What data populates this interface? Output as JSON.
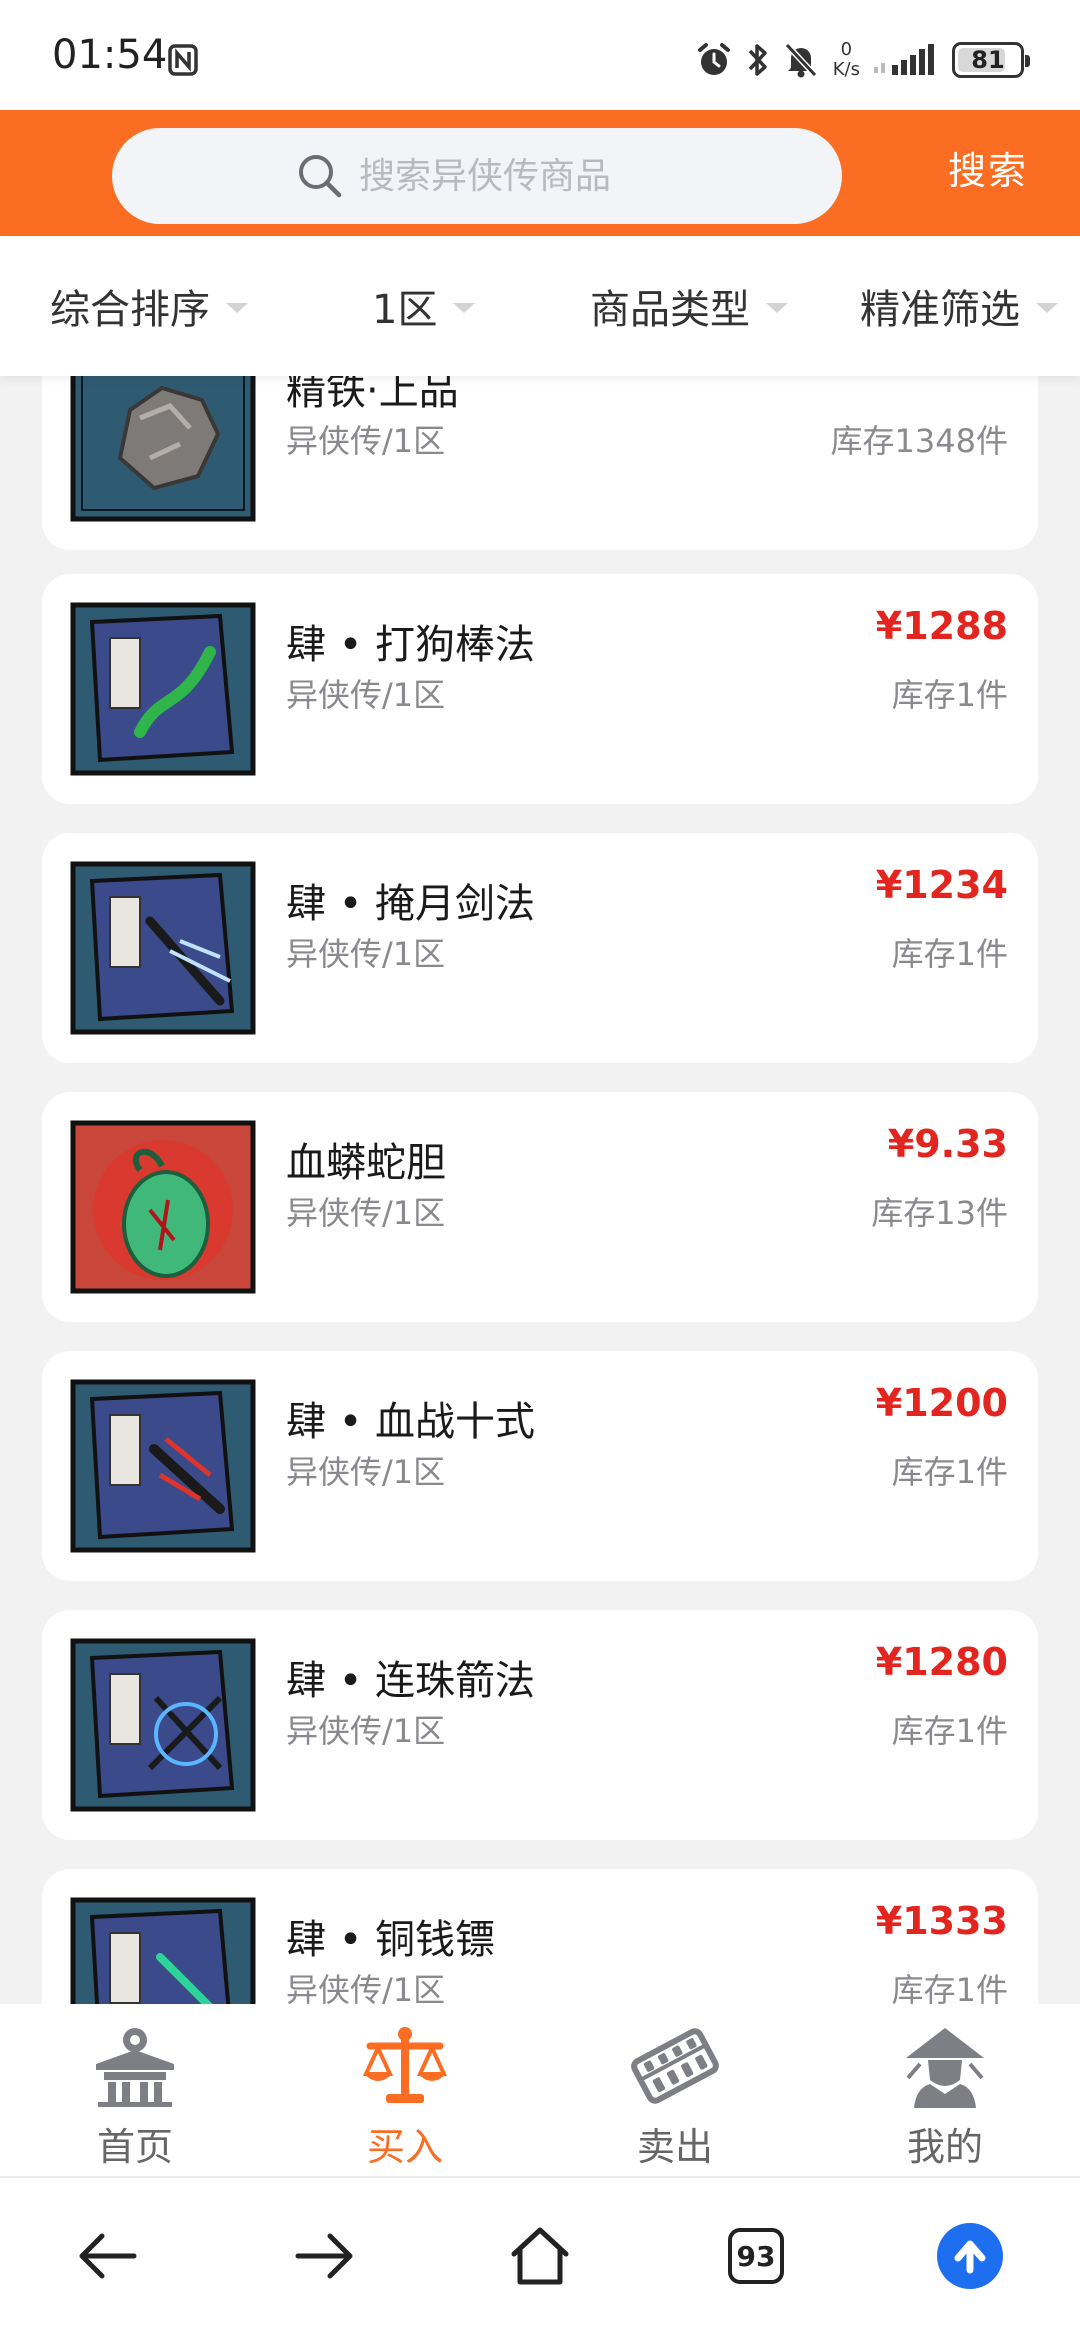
{
  "status_bar": {
    "time": "01:54",
    "net_speed_value": "0",
    "net_speed_unit": "K/s",
    "battery": "81",
    "battery_level": 0.81,
    "icons": [
      "nfc-icon",
      "alarm-icon",
      "bluetooth-icon",
      "mute-icon",
      "signal-icon",
      "battery-icon"
    ]
  },
  "search": {
    "placeholder": "搜索异侠传商品",
    "button_label": "搜索",
    "icon": "search-icon"
  },
  "filters": [
    {
      "label": "综合排序",
      "icon": "caret-down-icon"
    },
    {
      "label": "1区",
      "icon": "caret-down-icon"
    },
    {
      "label": "商品类型",
      "icon": "caret-down-icon"
    },
    {
      "label": "精准筛选",
      "icon": "caret-down-icon"
    }
  ],
  "products": [
    {
      "name": "精铁·上品",
      "sub": "异侠传/1区",
      "price": "",
      "stock": "库存1348件",
      "thumb": "iron-ore-icon"
    },
    {
      "name": "肆 • 打狗棒法",
      "sub": "异侠传/1区",
      "price": "¥1288",
      "stock": "库存1件",
      "thumb": "skill-book-icon"
    },
    {
      "name": "肆 • 掩月剑法",
      "sub": "异侠传/1区",
      "price": "¥1234",
      "stock": "库存1件",
      "thumb": "skill-book-icon"
    },
    {
      "name": "血蟒蛇胆",
      "sub": "异侠传/1区",
      "price": "¥9.33",
      "stock": "库存13件",
      "thumb": "snake-gall-icon"
    },
    {
      "name": "肆 • 血战十式",
      "sub": "异侠传/1区",
      "price": "¥1200",
      "stock": "库存1件",
      "thumb": "skill-book-icon"
    },
    {
      "name": "肆 • 连珠箭法",
      "sub": "异侠传/1区",
      "price": "¥1280",
      "stock": "库存1件",
      "thumb": "skill-book-icon"
    },
    {
      "name": "肆 • 铜钱镖",
      "sub": "异侠传/1区",
      "price": "¥1333",
      "stock": "库存1件",
      "thumb": "skill-book-icon"
    }
  ],
  "tabs": [
    {
      "label": "首页",
      "icon": "home-building-icon",
      "active": false
    },
    {
      "label": "买入",
      "icon": "scale-icon",
      "active": true
    },
    {
      "label": "卖出",
      "icon": "abacus-icon",
      "active": false
    },
    {
      "label": "我的",
      "icon": "swordsman-avatar-icon",
      "active": false
    }
  ],
  "browser_nav": {
    "tab_count": "93",
    "icons": [
      "back-arrow-icon",
      "forward-arrow-icon",
      "home-icon",
      "tabs-icon",
      "upload-icon"
    ]
  },
  "colors": {
    "brand_orange": "#fa6d23",
    "price_red": "#e2261f",
    "page_background": "#f2f2f3",
    "upload_blue": "#1e6ef0"
  }
}
